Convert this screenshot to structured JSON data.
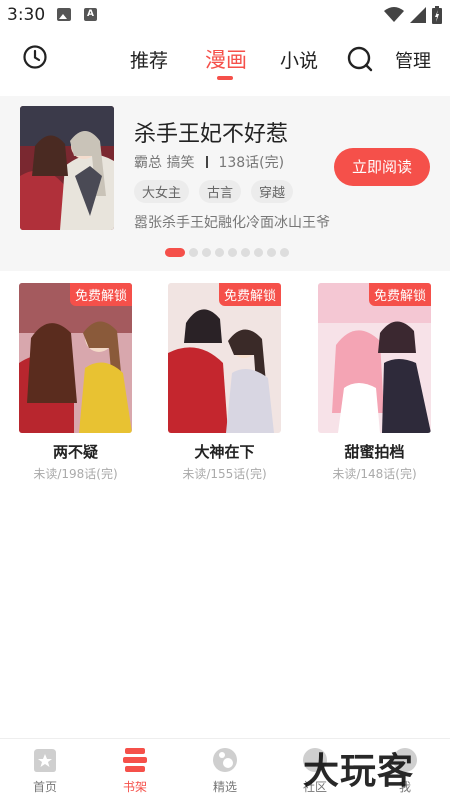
{
  "status_bar": {
    "time": "3:30"
  },
  "top_nav": {
    "tabs": [
      {
        "label": "推荐"
      },
      {
        "label": "漫画"
      },
      {
        "label": "小说"
      }
    ],
    "active_tab": "漫画",
    "manage_label": "管理"
  },
  "banner": {
    "title": "杀手王妃不好惹",
    "genres": "霸总 搞笑",
    "chapters": "138话(完)",
    "tags": [
      "大女主",
      "古言",
      "穿越"
    ],
    "description": "嚣张杀手王妃融化冷面冰山王爷",
    "read_button": "立即阅读",
    "page_indicator": {
      "total": 9,
      "current": 1
    }
  },
  "comics": [
    {
      "badge": "免费解锁",
      "title": "两不疑",
      "progress": "未读/198话(完)"
    },
    {
      "badge": "免费解锁",
      "title": "大神在下",
      "progress": "未读/155话(完)"
    },
    {
      "badge": "免费解锁",
      "title": "甜蜜拍档",
      "progress": "未读/148话(完)"
    }
  ],
  "bottom_nav": {
    "items": [
      {
        "label": "首页",
        "icon": "home-icon"
      },
      {
        "label": "书架",
        "icon": "bookshelf-icon"
      },
      {
        "label": "精选",
        "icon": "featured-icon"
      },
      {
        "label": "社区",
        "icon": "community-icon"
      },
      {
        "label": "我",
        "icon": "profile-icon"
      }
    ],
    "active": "书架"
  },
  "watermark": "大玩客",
  "colors": {
    "accent": "#f5504a",
    "banner_bg": "#f6f6f6",
    "muted_text": "#aaaaaa"
  }
}
